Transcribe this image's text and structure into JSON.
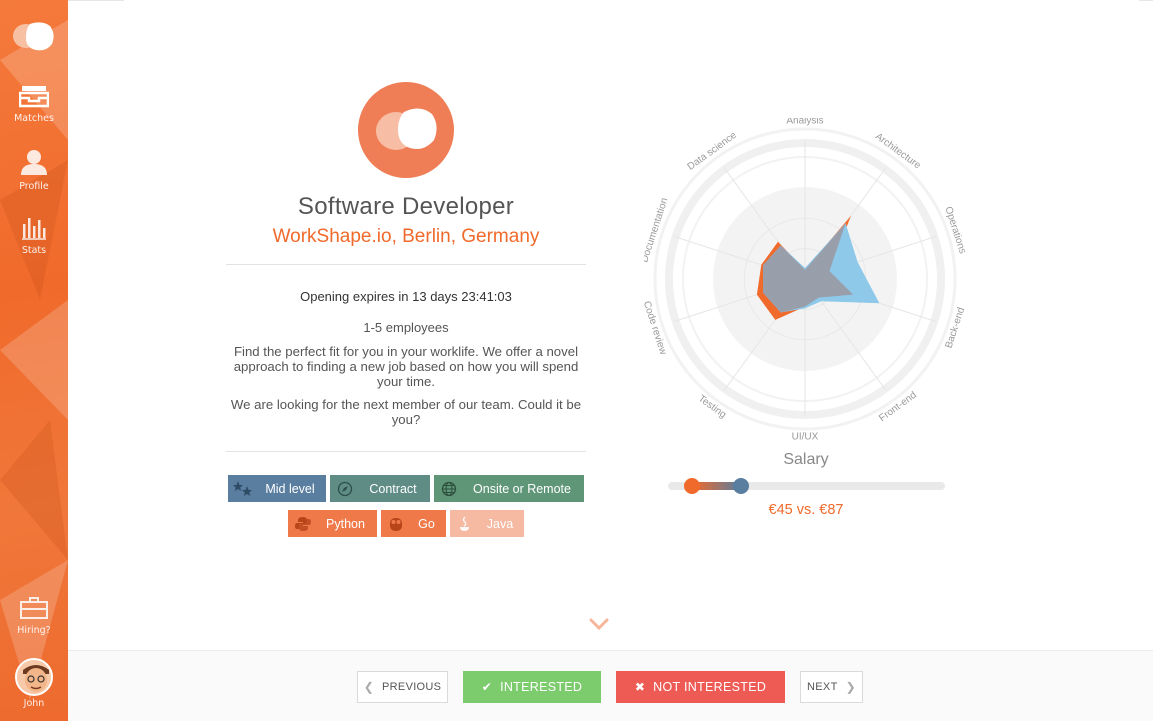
{
  "sidebar": {
    "items": [
      {
        "label": "Matches"
      },
      {
        "label": "Profile"
      },
      {
        "label": "Stats"
      },
      {
        "label": "Hiring?"
      },
      {
        "label": "John"
      }
    ]
  },
  "job": {
    "title": "Software Developer",
    "company": "WorkShape.io, Berlin, Germany",
    "expires": "Opening expires in 13 days 23:41:03",
    "employees": "1-5 employees",
    "description": "Find the perfect fit for you in your worklife. We offer a novel approach to finding a new job based on how you will spend your time.",
    "description2": "We are looking for the next member of our team. Could it be you?"
  },
  "tags": {
    "level": "Mid level",
    "contract": "Contract",
    "location": "Onsite or Remote",
    "skills": [
      "Python",
      "Go",
      "Java"
    ]
  },
  "radar": {
    "axes": [
      "Analysis",
      "Architecture",
      "Operations",
      "Back-end",
      "Front-end",
      "UI/UX",
      "Testing",
      "Code review",
      "Documentation",
      "Data science"
    ],
    "series": [
      {
        "color": "#f06a2b",
        "values": [
          0.1,
          0.85,
          0.28,
          0.55,
          0.25,
          0.3,
          0.55,
          0.55,
          0.5,
          0.5
        ]
      },
      {
        "color": "#8ec9ea",
        "values": [
          0.12,
          0.75,
          0.6,
          0.85,
          0.3,
          0.32,
          0.45,
          0.48,
          0.48,
          0.45
        ]
      }
    ]
  },
  "salary": {
    "title": "Salary",
    "value_text": "€45 vs. €87",
    "low_fraction": 0.085,
    "high_fraction": 0.265
  },
  "footer": {
    "previous": "PREVIOUS",
    "interested": "INTERESTED",
    "not_interested": "NOT INTERESTED",
    "next": "NEXT"
  },
  "colors": {
    "accent": "#f06a2b",
    "green": "#7ccc6e",
    "red": "#ee5b55",
    "tag_blue": "#5a7ea0",
    "tag_teal": "#5f8d86",
    "tag_green": "#5f9678",
    "tag_orange": "#f0794a",
    "tag_orange_light": "#f6b9a2"
  }
}
